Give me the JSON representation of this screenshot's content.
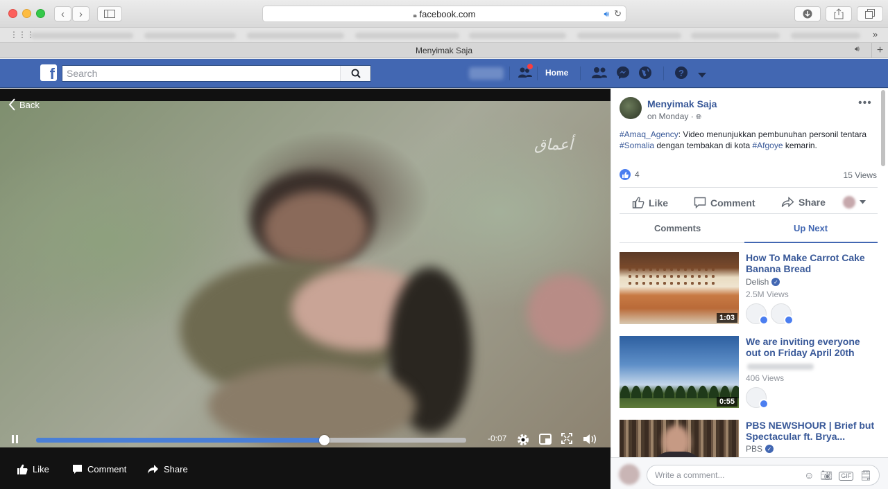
{
  "browser": {
    "url": "facebook.com",
    "tab_title": "Menyimak Saja"
  },
  "fb_header": {
    "search_placeholder": "Search",
    "home_label": "Home"
  },
  "video": {
    "back_label": "Back",
    "time_remaining": "-0:07",
    "progress": 0.67,
    "actions": {
      "like": "Like",
      "comment": "Comment",
      "share": "Share"
    }
  },
  "post": {
    "author": "Menyimak Saja",
    "time": "on Monday",
    "text_parts": {
      "tag1": "#Amaq_Agency",
      "t1": ": Video menunjukkan pembunuhan personil tentara ",
      "tag2": "#Somalia",
      "t2": " dengan tembakan di kota ",
      "tag3": "#Afgoye",
      "t3": " kemarin."
    },
    "like_count": "4",
    "views": "15 Views",
    "actions": {
      "like": "Like",
      "comment": "Comment",
      "share": "Share"
    },
    "tabs": {
      "comments": "Comments",
      "up_next": "Up Next"
    }
  },
  "up_next": [
    {
      "title": "How To Make Carrot Cake Banana Bread",
      "channel": "Delish",
      "views": "2.5M Views",
      "duration": "1:03"
    },
    {
      "title": "We are inviting everyone out on Friday April 20th",
      "channel": "",
      "views": "406 Views",
      "duration": "0:55"
    },
    {
      "title": "PBS NEWSHOUR | Brief but Spectacular ft. Brya...",
      "channel": "PBS",
      "views": "",
      "duration": ""
    }
  ],
  "comment_box": {
    "placeholder": "Write a comment..."
  },
  "colors": {
    "fb_blue": "#4267b2",
    "link": "#385898",
    "progress": "#4a7fd6"
  }
}
